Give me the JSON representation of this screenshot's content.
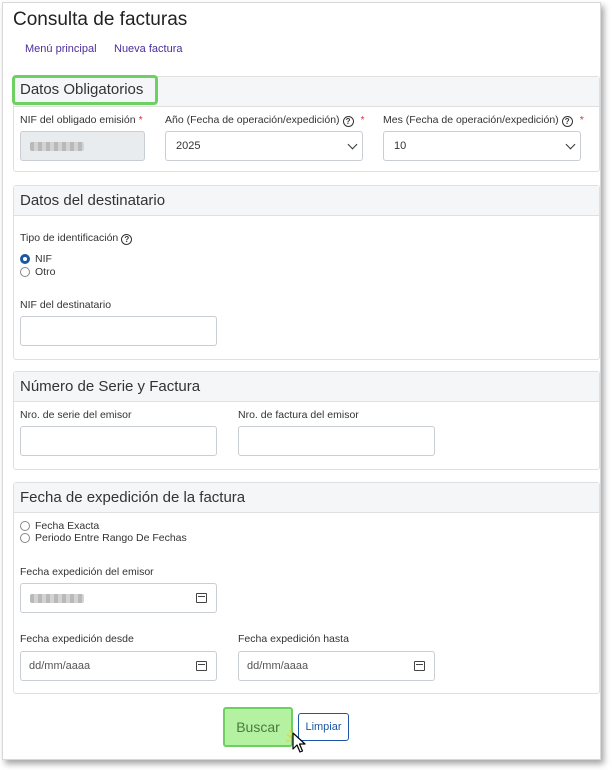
{
  "page": {
    "title": "Consulta de facturas"
  },
  "nav": {
    "menu": "Menú principal",
    "new_invoice": "Nueva factura"
  },
  "datos_obligatorios": {
    "heading": "Datos Obligatorios",
    "nif_label": "NIF del obligado emisión",
    "anio_label": "Año (Fecha de operación/expedición)",
    "anio_value": "2025",
    "mes_label": "Mes (Fecha de operación/expedición)",
    "mes_value": "10",
    "required_mark": "*"
  },
  "destinatario": {
    "heading": "Datos del destinatario",
    "tipo_label": "Tipo de identificación",
    "option_nif": "NIF",
    "option_otro": "Otro",
    "nif_label": "NIF del destinatario"
  },
  "serie": {
    "heading": "Número de Serie y Factura",
    "serie_label": "Nro. de serie del emisor",
    "factura_label": "Nro. de factura del emisor"
  },
  "fecha": {
    "heading": "Fecha de expedición de la factura",
    "option_exacta": "Fecha Exacta",
    "option_rango": "Periodo Entre Rango De Fechas",
    "emisor_label": "Fecha expedición del emisor",
    "desde_label": "Fecha expedición desde",
    "hasta_label": "Fecha expedición hasta",
    "date_placeholder": "dd/mm/aaaa"
  },
  "actions": {
    "buscar": "Buscar",
    "limpiar": "Limpiar"
  },
  "colors": {
    "highlight": "#6ed063",
    "primary": "#1b57a6",
    "link": "#4b2e9c"
  }
}
